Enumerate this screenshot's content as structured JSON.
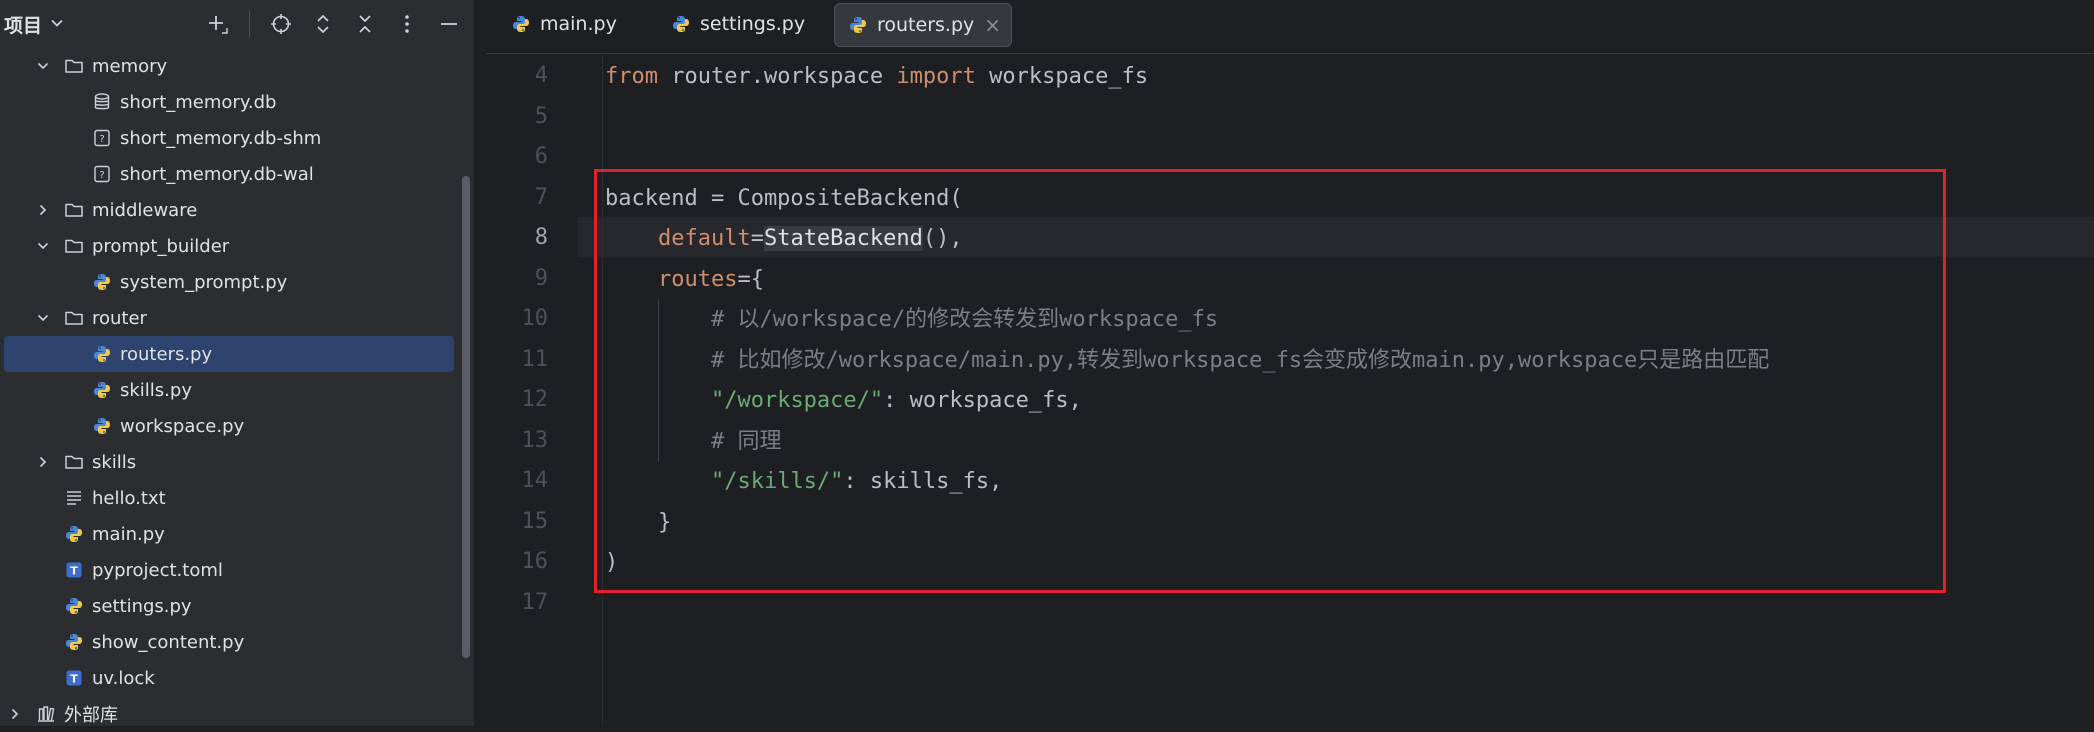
{
  "panel": {
    "title": "项目",
    "tree": [
      {
        "label": "memory",
        "type": "folder",
        "expanded": true,
        "depth": 1,
        "icon": "folder-icon"
      },
      {
        "label": "short_memory.db",
        "type": "file",
        "depth": 2,
        "icon": "database-icon"
      },
      {
        "label": "short_memory.db-shm",
        "type": "file",
        "depth": 2,
        "icon": "unknown-file-icon"
      },
      {
        "label": "short_memory.db-wal",
        "type": "file",
        "depth": 2,
        "icon": "unknown-file-icon"
      },
      {
        "label": "middleware",
        "type": "folder",
        "expanded": false,
        "depth": 1,
        "icon": "folder-icon"
      },
      {
        "label": "prompt_builder",
        "type": "folder",
        "expanded": true,
        "depth": 1,
        "icon": "folder-icon"
      },
      {
        "label": "system_prompt.py",
        "type": "file",
        "depth": 2,
        "icon": "python-file-icon"
      },
      {
        "label": "router",
        "type": "folder",
        "expanded": true,
        "depth": 1,
        "icon": "folder-icon"
      },
      {
        "label": "routers.py",
        "type": "file",
        "depth": 2,
        "icon": "python-file-icon",
        "selected": true
      },
      {
        "label": "skills.py",
        "type": "file",
        "depth": 2,
        "icon": "python-file-icon"
      },
      {
        "label": "workspace.py",
        "type": "file",
        "depth": 2,
        "icon": "python-file-icon"
      },
      {
        "label": "skills",
        "type": "folder",
        "expanded": false,
        "depth": 1,
        "icon": "folder-icon"
      },
      {
        "label": "hello.txt",
        "type": "file",
        "depth": 1,
        "icon": "text-file-icon"
      },
      {
        "label": "main.py",
        "type": "file",
        "depth": 1,
        "icon": "python-file-icon"
      },
      {
        "label": "pyproject.toml",
        "type": "file",
        "depth": 1,
        "icon": "toml-file-icon"
      },
      {
        "label": "settings.py",
        "type": "file",
        "depth": 1,
        "icon": "python-file-icon"
      },
      {
        "label": "show_content.py",
        "type": "file",
        "depth": 1,
        "icon": "python-file-icon"
      },
      {
        "label": "uv.lock",
        "type": "file",
        "depth": 1,
        "icon": "toml-file-icon"
      },
      {
        "label": "外部库",
        "type": "library",
        "expanded": false,
        "depth": 0,
        "icon": "library-icon"
      }
    ]
  },
  "tabs": [
    {
      "label": "main.py",
      "active": false
    },
    {
      "label": "settings.py",
      "active": false
    },
    {
      "label": "routers.py",
      "active": true
    }
  ],
  "editor": {
    "current_line": 8,
    "lines": [
      {
        "n": "4",
        "tokens": [
          [
            "kw",
            "from"
          ],
          [
            "id",
            " router.workspace "
          ],
          [
            "kw",
            "import"
          ],
          [
            "id",
            " workspace_fs"
          ]
        ]
      },
      {
        "n": "5",
        "tokens": []
      },
      {
        "n": "6",
        "tokens": []
      },
      {
        "n": "7",
        "tokens": [
          [
            "id",
            "backend = CompositeBackend("
          ]
        ]
      },
      {
        "n": "8",
        "tokens": [
          [
            "id",
            "    "
          ],
          [
            "param",
            "default"
          ],
          [
            "id",
            "="
          ],
          [
            "hl",
            "StateBackend"
          ],
          [
            "id",
            "(),"
          ]
        ]
      },
      {
        "n": "9",
        "tokens": [
          [
            "id",
            "    "
          ],
          [
            "param",
            "routes"
          ],
          [
            "id",
            "={"
          ]
        ]
      },
      {
        "n": "10",
        "tokens": [
          [
            "id",
            "        "
          ],
          [
            "cmt",
            "# 以/workspace/的修改会转发到workspace_fs"
          ]
        ]
      },
      {
        "n": "11",
        "tokens": [
          [
            "id",
            "        "
          ],
          [
            "cmt",
            "# 比如修改/workspace/main.py,转发到workspace_fs会变成修改main.py,workspace只是路由匹配"
          ]
        ]
      },
      {
        "n": "12",
        "tokens": [
          [
            "id",
            "        "
          ],
          [
            "str",
            "\"/workspace/\""
          ],
          [
            "id",
            ": workspace_fs,"
          ]
        ]
      },
      {
        "n": "13",
        "tokens": [
          [
            "id",
            "        "
          ],
          [
            "cmt",
            "# 同理"
          ]
        ]
      },
      {
        "n": "14",
        "tokens": [
          [
            "id",
            "        "
          ],
          [
            "str",
            "\"/skills/\""
          ],
          [
            "id",
            ": skills_fs,"
          ]
        ]
      },
      {
        "n": "15",
        "tokens": [
          [
            "id",
            "    }"
          ]
        ]
      },
      {
        "n": "16",
        "tokens": [
          [
            "id",
            ")"
          ]
        ]
      },
      {
        "n": "17",
        "tokens": []
      }
    ]
  },
  "colors": {
    "annotation_box": "#e3212b",
    "selection": "#2e436e",
    "keyword": "#cf8e6d",
    "string": "#6aab73",
    "comment": "#7a7e85"
  }
}
